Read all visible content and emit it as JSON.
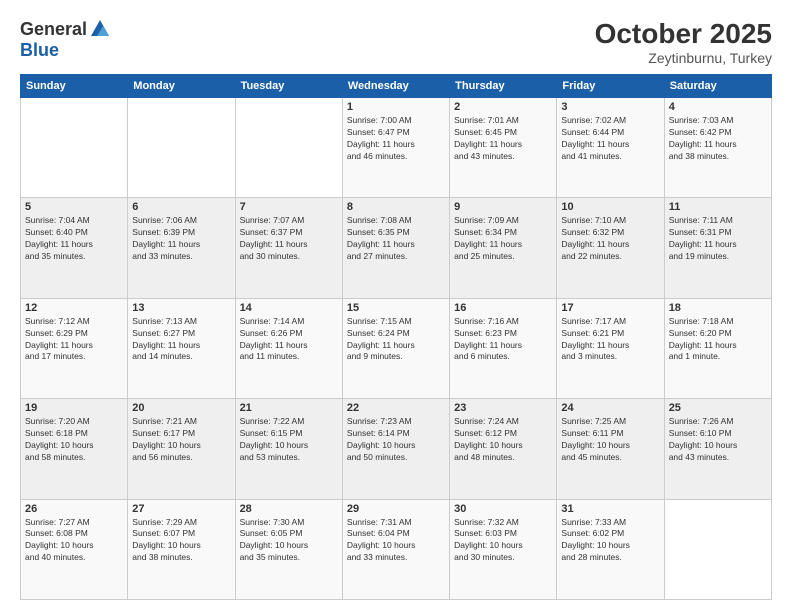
{
  "header": {
    "logo_general": "General",
    "logo_blue": "Blue",
    "month": "October 2025",
    "location": "Zeytinburnu, Turkey"
  },
  "days_of_week": [
    "Sunday",
    "Monday",
    "Tuesday",
    "Wednesday",
    "Thursday",
    "Friday",
    "Saturday"
  ],
  "weeks": [
    [
      {
        "day": "",
        "info": ""
      },
      {
        "day": "",
        "info": ""
      },
      {
        "day": "",
        "info": ""
      },
      {
        "day": "1",
        "info": "Sunrise: 7:00 AM\nSunset: 6:47 PM\nDaylight: 11 hours\nand 46 minutes."
      },
      {
        "day": "2",
        "info": "Sunrise: 7:01 AM\nSunset: 6:45 PM\nDaylight: 11 hours\nand 43 minutes."
      },
      {
        "day": "3",
        "info": "Sunrise: 7:02 AM\nSunset: 6:44 PM\nDaylight: 11 hours\nand 41 minutes."
      },
      {
        "day": "4",
        "info": "Sunrise: 7:03 AM\nSunset: 6:42 PM\nDaylight: 11 hours\nand 38 minutes."
      }
    ],
    [
      {
        "day": "5",
        "info": "Sunrise: 7:04 AM\nSunset: 6:40 PM\nDaylight: 11 hours\nand 35 minutes."
      },
      {
        "day": "6",
        "info": "Sunrise: 7:06 AM\nSunset: 6:39 PM\nDaylight: 11 hours\nand 33 minutes."
      },
      {
        "day": "7",
        "info": "Sunrise: 7:07 AM\nSunset: 6:37 PM\nDaylight: 11 hours\nand 30 minutes."
      },
      {
        "day": "8",
        "info": "Sunrise: 7:08 AM\nSunset: 6:35 PM\nDaylight: 11 hours\nand 27 minutes."
      },
      {
        "day": "9",
        "info": "Sunrise: 7:09 AM\nSunset: 6:34 PM\nDaylight: 11 hours\nand 25 minutes."
      },
      {
        "day": "10",
        "info": "Sunrise: 7:10 AM\nSunset: 6:32 PM\nDaylight: 11 hours\nand 22 minutes."
      },
      {
        "day": "11",
        "info": "Sunrise: 7:11 AM\nSunset: 6:31 PM\nDaylight: 11 hours\nand 19 minutes."
      }
    ],
    [
      {
        "day": "12",
        "info": "Sunrise: 7:12 AM\nSunset: 6:29 PM\nDaylight: 11 hours\nand 17 minutes."
      },
      {
        "day": "13",
        "info": "Sunrise: 7:13 AM\nSunset: 6:27 PM\nDaylight: 11 hours\nand 14 minutes."
      },
      {
        "day": "14",
        "info": "Sunrise: 7:14 AM\nSunset: 6:26 PM\nDaylight: 11 hours\nand 11 minutes."
      },
      {
        "day": "15",
        "info": "Sunrise: 7:15 AM\nSunset: 6:24 PM\nDaylight: 11 hours\nand 9 minutes."
      },
      {
        "day": "16",
        "info": "Sunrise: 7:16 AM\nSunset: 6:23 PM\nDaylight: 11 hours\nand 6 minutes."
      },
      {
        "day": "17",
        "info": "Sunrise: 7:17 AM\nSunset: 6:21 PM\nDaylight: 11 hours\nand 3 minutes."
      },
      {
        "day": "18",
        "info": "Sunrise: 7:18 AM\nSunset: 6:20 PM\nDaylight: 11 hours\nand 1 minute."
      }
    ],
    [
      {
        "day": "19",
        "info": "Sunrise: 7:20 AM\nSunset: 6:18 PM\nDaylight: 10 hours\nand 58 minutes."
      },
      {
        "day": "20",
        "info": "Sunrise: 7:21 AM\nSunset: 6:17 PM\nDaylight: 10 hours\nand 56 minutes."
      },
      {
        "day": "21",
        "info": "Sunrise: 7:22 AM\nSunset: 6:15 PM\nDaylight: 10 hours\nand 53 minutes."
      },
      {
        "day": "22",
        "info": "Sunrise: 7:23 AM\nSunset: 6:14 PM\nDaylight: 10 hours\nand 50 minutes."
      },
      {
        "day": "23",
        "info": "Sunrise: 7:24 AM\nSunset: 6:12 PM\nDaylight: 10 hours\nand 48 minutes."
      },
      {
        "day": "24",
        "info": "Sunrise: 7:25 AM\nSunset: 6:11 PM\nDaylight: 10 hours\nand 45 minutes."
      },
      {
        "day": "25",
        "info": "Sunrise: 7:26 AM\nSunset: 6:10 PM\nDaylight: 10 hours\nand 43 minutes."
      }
    ],
    [
      {
        "day": "26",
        "info": "Sunrise: 7:27 AM\nSunset: 6:08 PM\nDaylight: 10 hours\nand 40 minutes."
      },
      {
        "day": "27",
        "info": "Sunrise: 7:29 AM\nSunset: 6:07 PM\nDaylight: 10 hours\nand 38 minutes."
      },
      {
        "day": "28",
        "info": "Sunrise: 7:30 AM\nSunset: 6:05 PM\nDaylight: 10 hours\nand 35 minutes."
      },
      {
        "day": "29",
        "info": "Sunrise: 7:31 AM\nSunset: 6:04 PM\nDaylight: 10 hours\nand 33 minutes."
      },
      {
        "day": "30",
        "info": "Sunrise: 7:32 AM\nSunset: 6:03 PM\nDaylight: 10 hours\nand 30 minutes."
      },
      {
        "day": "31",
        "info": "Sunrise: 7:33 AM\nSunset: 6:02 PM\nDaylight: 10 hours\nand 28 minutes."
      },
      {
        "day": "",
        "info": ""
      }
    ]
  ]
}
